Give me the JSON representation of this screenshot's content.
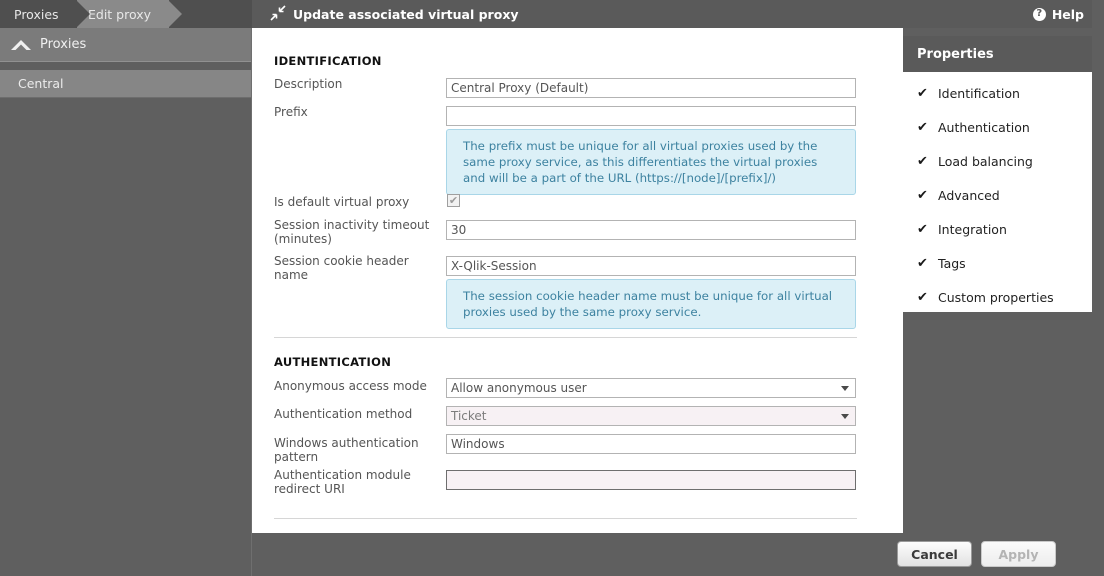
{
  "breadcrumb": {
    "items": [
      {
        "label": "Proxies",
        "active": false
      },
      {
        "label": "Edit proxy",
        "active": true
      }
    ]
  },
  "sidebar": {
    "header": {
      "label": "Proxies",
      "icon": "chevron-up-icon"
    },
    "items": [
      {
        "label": "Central",
        "selected": true
      }
    ]
  },
  "topbar": {
    "icon": "collapse-arrows-icon",
    "title": "Update associated virtual proxy",
    "help_label": "Help",
    "help_icon": "question-circle-icon"
  },
  "form": {
    "identification": {
      "title": "IDENTIFICATION",
      "description": {
        "label": "Description",
        "value": "Central Proxy (Default)",
        "placeholder": ""
      },
      "prefix": {
        "label": "Prefix",
        "value": "",
        "placeholder": ""
      },
      "prefix_info": "The prefix must be unique for all virtual proxies used by the same proxy service, as this differentiates the virtual proxies and will be a part of the URL (https://[node]/[prefix]/)",
      "is_default": {
        "label": "Is default virtual proxy",
        "checked": true,
        "mark": "✔"
      },
      "session_timeout": {
        "label": "Session inactivity timeout (minutes)",
        "value": "30"
      },
      "session_cookie": {
        "label": "Session cookie header name",
        "value": "X-Qlik-Session"
      },
      "session_cookie_info": "The session cookie header name must be unique for all virtual proxies used by the same proxy service."
    },
    "authentication": {
      "title": "AUTHENTICATION",
      "anonymous_access": {
        "label": "Anonymous access mode",
        "value": "Allow anonymous user",
        "disabled": false
      },
      "auth_method": {
        "label": "Authentication method",
        "value": "Ticket",
        "disabled": true
      },
      "windows_pattern": {
        "label": "Windows authentication pattern",
        "value": "Windows"
      },
      "redirect_uri": {
        "label": "Authentication module redirect URI",
        "value": "",
        "placeholder": ""
      }
    }
  },
  "properties": {
    "title": "Properties",
    "items": [
      {
        "label": "Identification",
        "checked": true
      },
      {
        "label": "Authentication",
        "checked": true
      },
      {
        "label": "Load balancing",
        "checked": true
      },
      {
        "label": "Advanced",
        "checked": true
      },
      {
        "label": "Integration",
        "checked": true
      },
      {
        "label": "Tags",
        "checked": true
      },
      {
        "label": "Custom properties",
        "checked": true
      }
    ],
    "check_mark": "✔"
  },
  "footer": {
    "cancel_label": "Cancel",
    "apply_label": "Apply"
  },
  "colors": {
    "chrome": "#5f5f5f",
    "topbar": "#5a5a5a",
    "panel": "#ffffff",
    "info_bg": "#dcf0f7",
    "info_text": "#3d82a0",
    "required_bg": "#f7f1f4"
  }
}
